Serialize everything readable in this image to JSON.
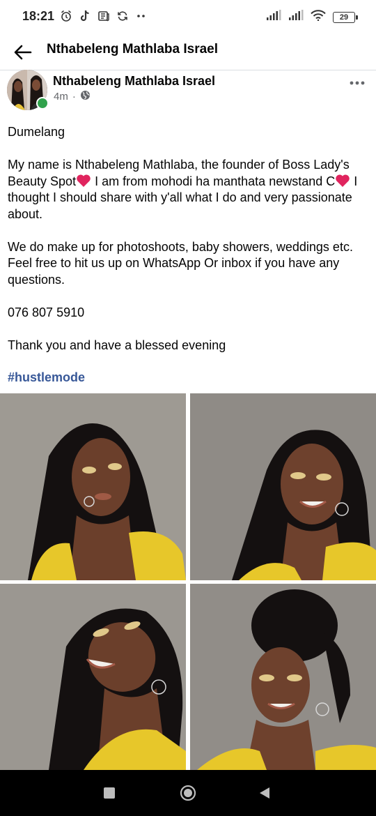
{
  "status_bar": {
    "time": "18:21",
    "battery": "29",
    "left_icons": [
      "alarm-icon",
      "tiktok-icon",
      "news-icon",
      "sync-icon",
      "more-dots-icon"
    ],
    "right_icons": [
      "signal-icon",
      "signal-icon",
      "wifi-icon",
      "battery-icon"
    ]
  },
  "appbar": {
    "title": "Nthabeleng Mathlaba Israel",
    "back_icon": "arrow-left-icon"
  },
  "post": {
    "author": "Nthabeleng Mathlaba Israel",
    "time": "4m",
    "separator": "·",
    "privacy_icon": "globe-icon",
    "greeting": "Dumelang",
    "para1_a": "My name is Nthabeleng Mathlaba, the founder of Boss Lady's Beauty Spot",
    "para1_b": " I am from mohodi ha manthata newstand C",
    "para1_c": " I thought I should share with y'all what I do and very passionate about.",
    "para2": "We do make up for photoshoots, baby showers, weddings etc. Feel free to hit us up on WhatsApp Or inbox if you have any questions.",
    "phone": "076 807 5910",
    "closing": "Thank you and have a blessed evening",
    "hashtag": "#hustlemode",
    "photo_count": 4
  },
  "colors": {
    "hashtag": "#385898",
    "online": "#31a24c",
    "meta": "#65676b",
    "heart": "#e0245e"
  },
  "navbar": {
    "icons": [
      "recents-square-icon",
      "home-circle-icon",
      "back-triangle-icon"
    ]
  }
}
